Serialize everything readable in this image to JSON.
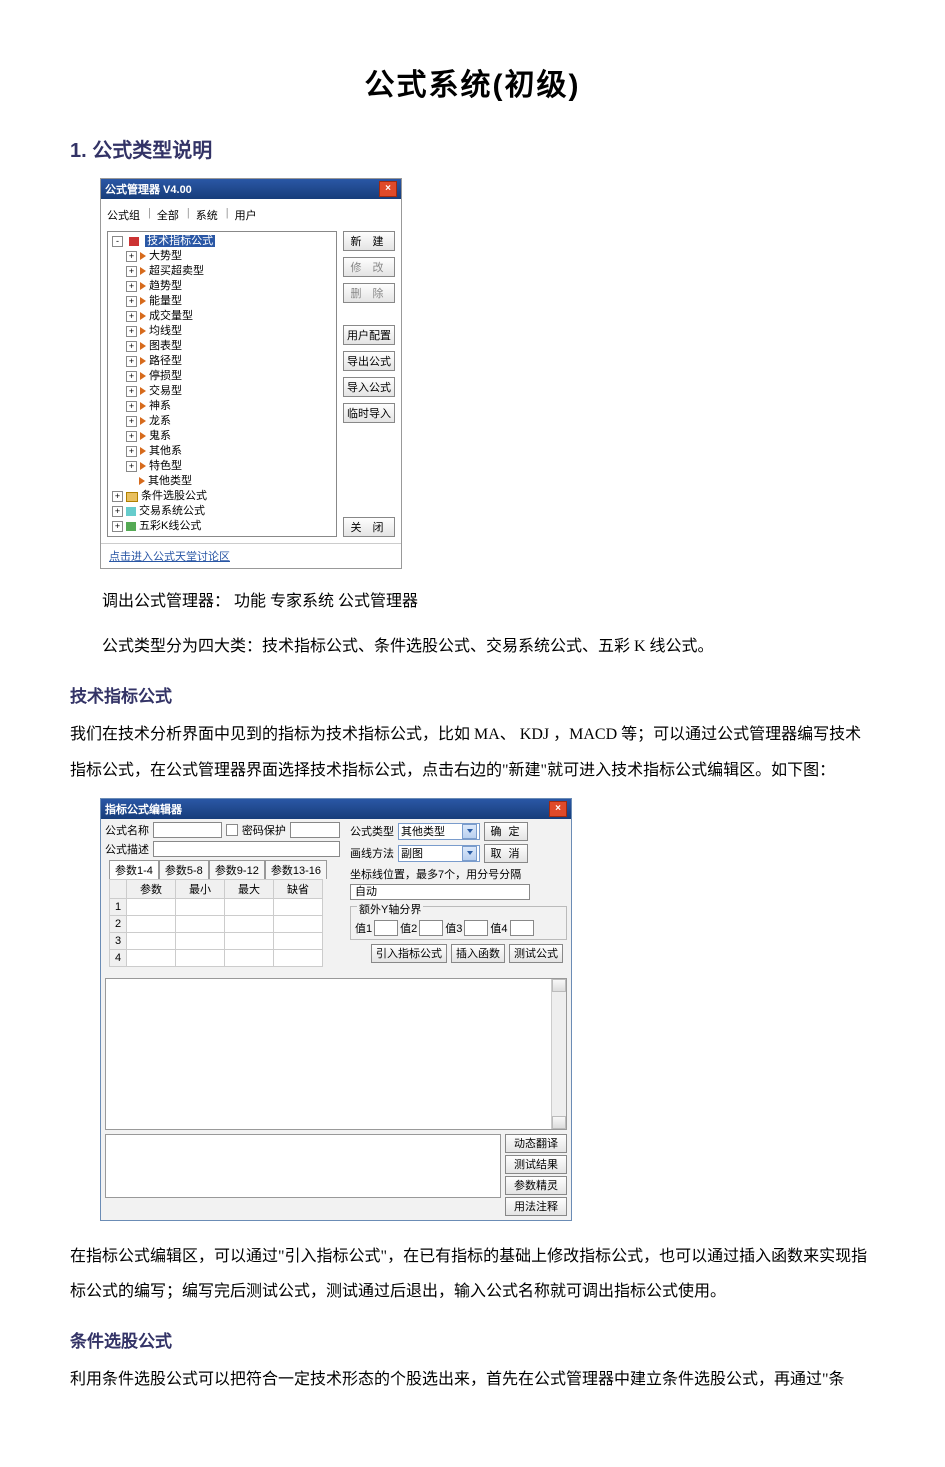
{
  "doc": {
    "title": "公式系统(初级)",
    "section1": "1. 公式类型说明",
    "p1": "调出公式管理器：  功能   专家系统   公式管理器",
    "p2": "公式类型分为四大类：技术指标公式、条件选股公式、交易系统公式、五彩 K 线公式。",
    "sub1": "技术指标公式",
    "p3": "我们在技术分析界面中见到的指标为技术指标公式，比如 MA、 KDJ ，MACD  等；可以通过公式管理器编写技术指标公式，在公式管理器界面选择技术指标公式，点击右边的\"新建\"就可进入技术指标公式编辑区。如下图：",
    "p4": "在指标公式编辑区，可以通过\"引入指标公式\"，在已有指标的基础上修改指标公式，也可以通过插入函数来实现指标公式的编写；编写完后测试公式，测试通过后退出，输入公式名称就可调出指标公式使用。",
    "sub2": "条件选股公式",
    "p5": "利用条件选股公式可以把符合一定技术形态的个股选出来，首先在公式管理器中建立条件选股公式，再通过\"条"
  },
  "win1": {
    "title": "公式管理器 V4.00",
    "menu": [
      "公式组",
      "全部",
      "系统",
      "用户"
    ],
    "tree": {
      "root": "技术指标公式",
      "children": [
        "大势型",
        "超买超卖型",
        "趋势型",
        "能量型",
        "成交量型",
        "均线型",
        "图表型",
        "路径型",
        "停损型",
        "交易型",
        "神系",
        "龙系",
        "鬼系",
        "其他系",
        "特色型",
        "其他类型"
      ],
      "siblings": [
        "条件选股公式",
        "交易系统公式",
        "五彩K线公式"
      ]
    },
    "buttons": [
      "新  建",
      "修  改",
      "删  除",
      "用户配置",
      "导出公式",
      "导入公式",
      "临时导入"
    ],
    "close": "关  闭",
    "footer_link": "点击进入公式天堂讨论区"
  },
  "win2": {
    "title": "指标公式编辑器",
    "labels": {
      "name": "公式名称",
      "desc": "公式描述",
      "pwd": "密码保护",
      "type": "公式类型",
      "draw": "画线方法",
      "axis_legend": "坐标线位置，最多7个，用分号分隔",
      "auto": "自动",
      "extra_legend": "额外Y轴分界",
      "v1": "值1",
      "v2": "值2",
      "v3": "值3",
      "v4": "值4"
    },
    "type_value": "其他类型",
    "draw_value": "副图",
    "ok": "确  定",
    "cancel": "取  消",
    "tabs": [
      "参数1-4",
      "参数5-8",
      "参数9-12",
      "参数13-16"
    ],
    "param_cols": [
      "参数",
      "最小",
      "最大",
      "缺省"
    ],
    "import": "引入指标公式",
    "insert_fn": "插入函数",
    "test": "测试公式",
    "side": [
      "动态翻译",
      "测试结果",
      "参数精灵",
      "用法注释"
    ]
  }
}
